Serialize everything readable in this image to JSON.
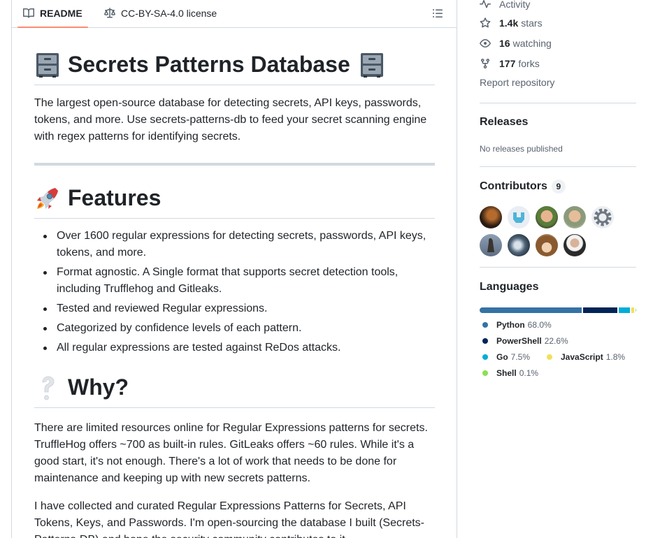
{
  "tabs": {
    "readme": "README",
    "license": "CC-BY-SA-4.0 license"
  },
  "readme": {
    "title": "Secrets Patterns Database",
    "intro": "The largest open-source database for detecting secrets, API keys, passwords, tokens, and more. Use secrets-patterns-db to feed your secret scanning engine with regex patterns for identifying secrets.",
    "features_heading": "Features",
    "features": [
      "Over 1600 regular expressions for detecting secrets, passwords, API keys, tokens, and more.",
      "Format agnostic. A Single format that supports secret detection tools, including Trufflehog and Gitleaks.",
      "Tested and reviewed Regular expressions.",
      "Categorized by confidence levels of each pattern.",
      "All regular expressions are tested against ReDos attacks."
    ],
    "why_heading": "Why?",
    "why_p1": "There are limited resources online for Regular Expressions patterns for secrets. TruffleHog offers ~700 as built-in rules. GitLeaks offers ~60 rules. While it's a good start, it's not enough. There's a lot of work that needs to be done for maintenance and keeping up with new secrets patterns.",
    "why_p2": "I have collected and curated Regular Expressions Patterns for Secrets, API Tokens, Keys, and Passwords. I'm open-sourcing the database I built (Secrets-Patterns-DB) and hope the security community contributes to it."
  },
  "sidebar": {
    "activity": "Activity",
    "stars_count": "1.4k",
    "stars_label": "stars",
    "watching_count": "16",
    "watching_label": "watching",
    "forks_count": "177",
    "forks_label": "forks",
    "report": "Report repository",
    "releases_heading": "Releases",
    "no_releases": "No releases published",
    "contributors_heading": "Contributors",
    "contributors_count": "9",
    "languages_heading": "Languages",
    "languages": [
      {
        "name": "Python",
        "percent": "68.0%",
        "color": "#3572A5",
        "value": 68.0
      },
      {
        "name": "PowerShell",
        "percent": "22.6%",
        "color": "#012456",
        "value": 22.6
      },
      {
        "name": "Go",
        "percent": "7.5%",
        "color": "#00ADD8",
        "value": 7.5
      },
      {
        "name": "JavaScript",
        "percent": "1.8%",
        "color": "#f1e05a",
        "value": 1.8
      },
      {
        "name": "Shell",
        "percent": "0.1%",
        "color": "#89e051",
        "value": 0.1
      }
    ]
  }
}
